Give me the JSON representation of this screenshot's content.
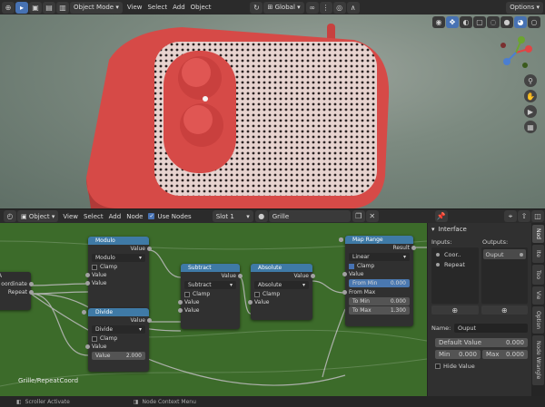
{
  "topbar": {
    "mode": "Object Mode",
    "menus": [
      "View",
      "Select",
      "Add",
      "Object"
    ],
    "transform": "Global",
    "options": "Options"
  },
  "node_header": {
    "type": "Object",
    "menus": [
      "View",
      "Select",
      "Add",
      "Node"
    ],
    "use_nodes": "Use Nodes",
    "slot": "Slot 1",
    "material": "Grille"
  },
  "nodes": {
    "modulo": {
      "title": "Modulo",
      "out": "Value",
      "mode": "Modulo",
      "clamp": "Clamp",
      "in1": "Value",
      "in2": "Value"
    },
    "divide": {
      "title": "Divide",
      "out": "Value",
      "mode": "Divide",
      "clamp": "Clamp",
      "in1": "Value",
      "in2_label": "Value",
      "in2_value": "2.000"
    },
    "subtract": {
      "title": "Subtract",
      "out": "Value",
      "mode": "Subtract",
      "clamp": "Clamp",
      "in1": "Value",
      "in2": "Value"
    },
    "absolute": {
      "title": "Absolute",
      "out": "Value",
      "mode": "Absolute",
      "clamp": "Clamp",
      "in1": "Value"
    },
    "maprange": {
      "title": "Map Range",
      "out": "Result",
      "mode": "Linear",
      "clamp": "Clamp",
      "value": "Value",
      "from_min_label": "From Min",
      "from_min": "0.000",
      "from_max": "From Max",
      "to_min_label": "To Min",
      "to_min": "0.000",
      "to_max_label": "To Max",
      "to_max": "1.300"
    },
    "group_input": {
      "title": "A",
      "out1": "oordinate",
      "out2": "Repeat"
    }
  },
  "group_label": "Grille/RepeatCoord",
  "interface": {
    "title": "Interface",
    "inputs_label": "Inputs:",
    "outputs_label": "Outputs:",
    "inputs": [
      "Coor..",
      "Repeat"
    ],
    "outputs": [
      "Ouput"
    ],
    "name_label": "Name:",
    "name_value": "Ouput",
    "default_label": "Default Value",
    "default_value": "0.000",
    "min_label": "Min",
    "min_value": "0.000",
    "max_label": "Max",
    "max_value": "0.000",
    "hide_value": "Hide Value"
  },
  "side_tabs": [
    "Nod",
    "Ite",
    "Too",
    "Vie",
    "Option",
    "Node Wrangle"
  ],
  "status": {
    "left": "Scroller Activate",
    "right": "Node Context Menu"
  },
  "colors": {
    "node_header": "#3f7aa6",
    "frame": "#3c6b2a",
    "accent": "#4772b3"
  }
}
